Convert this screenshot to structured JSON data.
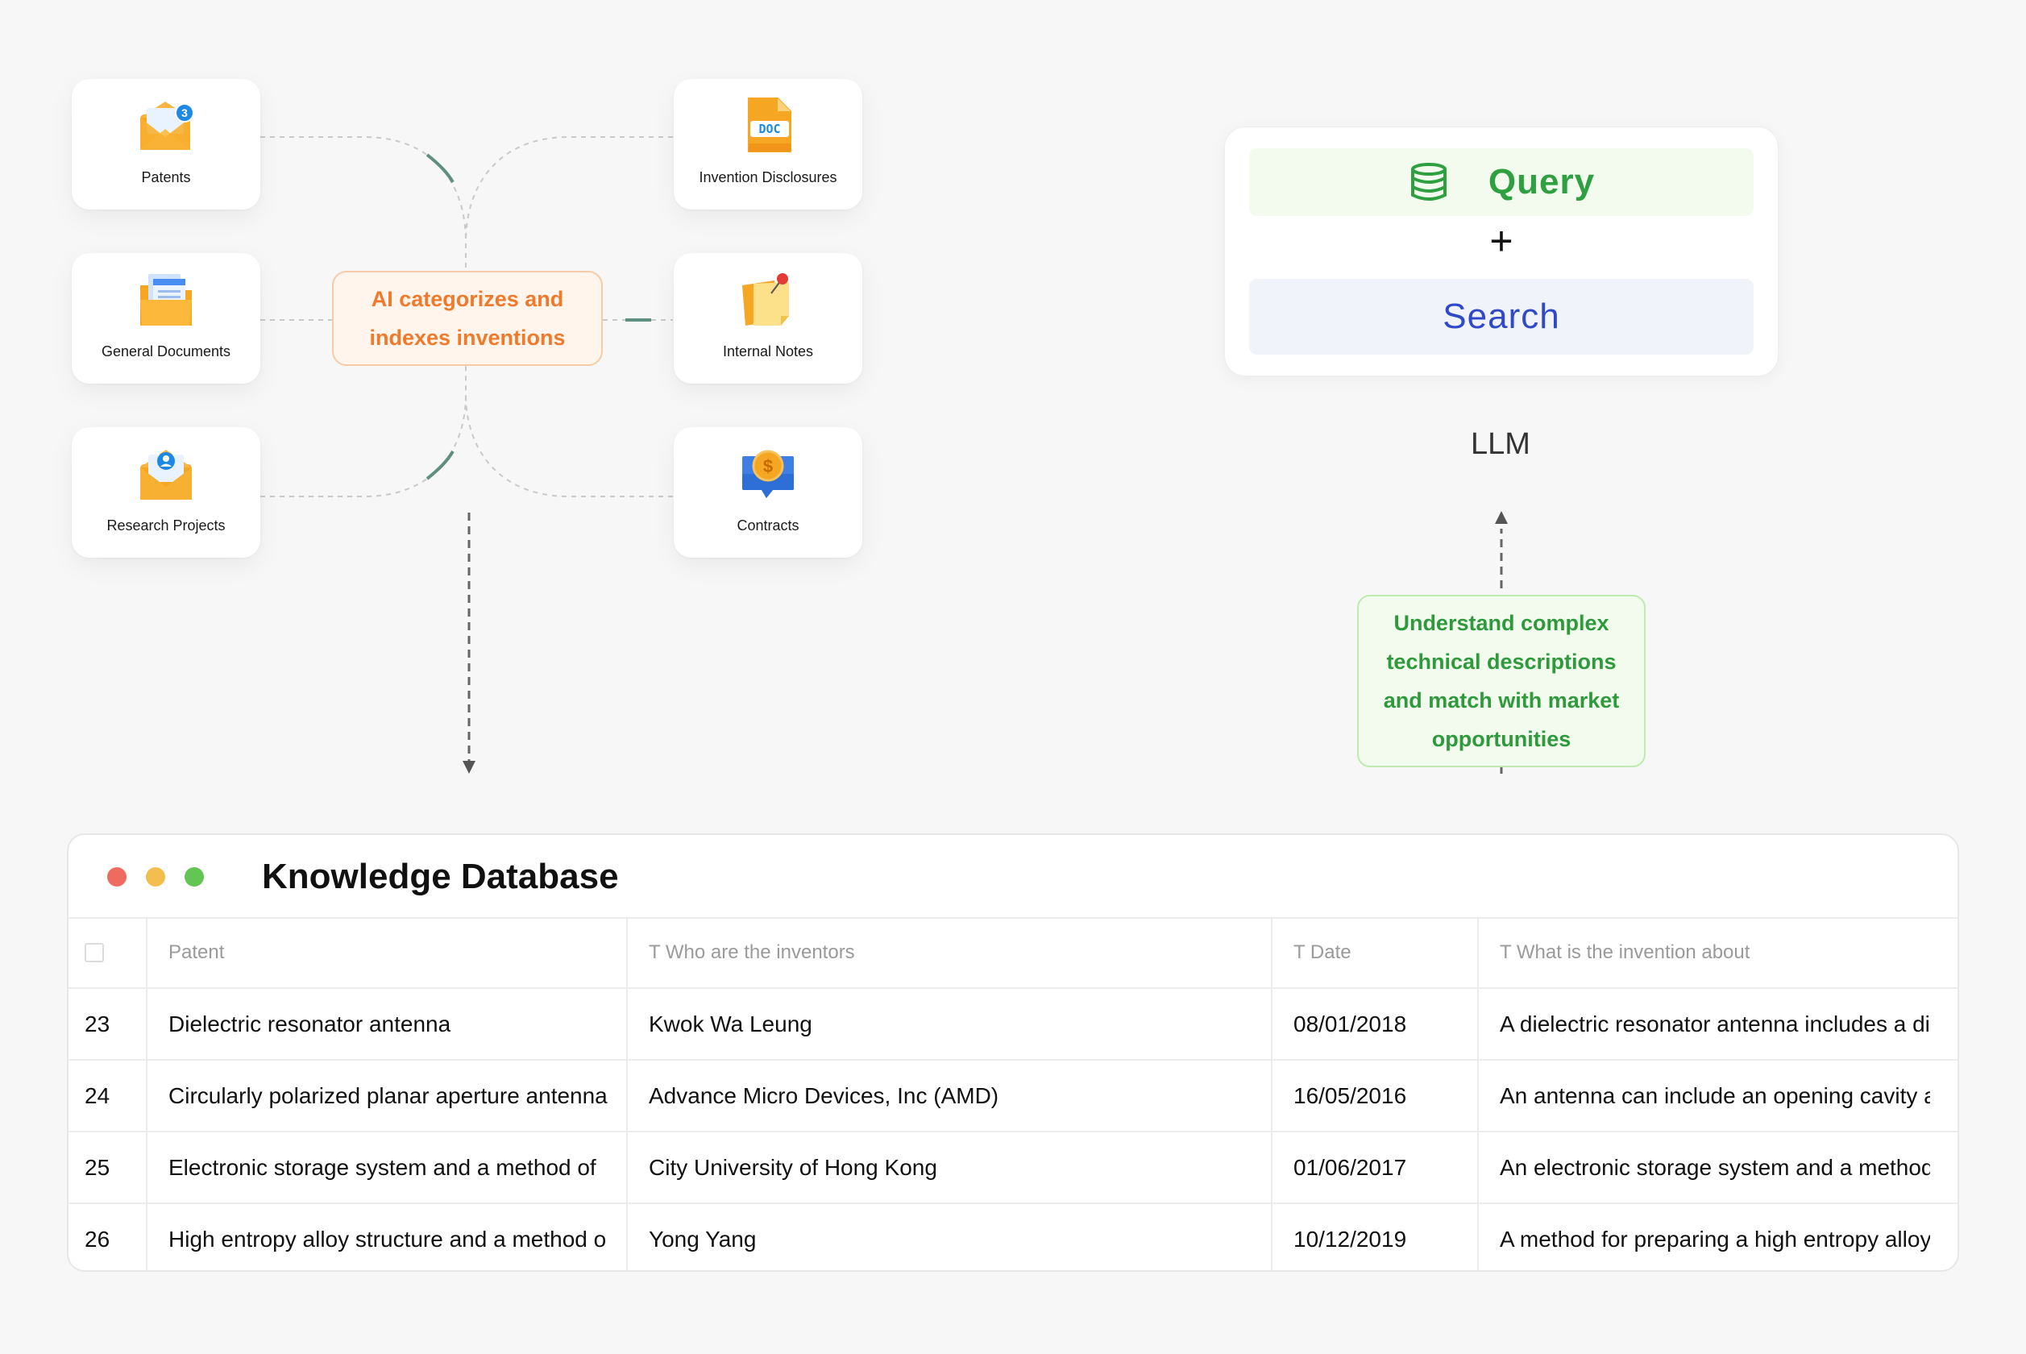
{
  "sources": {
    "patents": "Patents",
    "general_documents": "General Documents",
    "research_projects": "Research Projects",
    "invention_disclosures": "Invention Disclosures",
    "internal_notes": "Internal Notes",
    "contracts": "Contracts",
    "patents_badge": "3",
    "doc_badge": "DOC",
    "contract_symbol": "$"
  },
  "ai_box": {
    "line1": "AI categorizes and",
    "line2": "indexes inventions"
  },
  "query_panel": {
    "query": "Query",
    "plus": "+",
    "search": "Search"
  },
  "llm": "LLM",
  "understand_box": {
    "line1": "Understand complex",
    "line2": "technical descriptions",
    "line3": "and match with market",
    "line4": "opportunities"
  },
  "database": {
    "title": "Knowledge Database",
    "columns": [
      "Patent",
      "T Who are the inventors",
      "T Date",
      "T What is the invention about"
    ],
    "rows": [
      {
        "id": "23",
        "patent": "Dielectric resonator antenna",
        "inventors": "Kwok Wa Leung",
        "date": "08/01/2018",
        "about": "A dielectric resonator antenna includes a di"
      },
      {
        "id": "24",
        "patent": "Circularly polarized planar aperture antenna",
        "inventors": "Advance Micro Devices, Inc (AMD)",
        "date": "16/05/2016",
        "about": "An antenna can include an opening cavity an"
      },
      {
        "id": "25",
        "patent": "Electronic storage system and a method of",
        "inventors": "City University of Hong Kong",
        "date": "01/06/2017",
        "about": "An electronic storage system and a method o"
      },
      {
        "id": "26",
        "patent": "High entropy alloy structure and a method o",
        "inventors": "Yong Yang",
        "date": "10/12/2019",
        "about": "A method for preparing a high entropy alloy s"
      }
    ]
  },
  "colors": {
    "orange_accent": "#f07a2c",
    "green_accent": "#2ea040",
    "blue_accent": "#2f49c8"
  }
}
